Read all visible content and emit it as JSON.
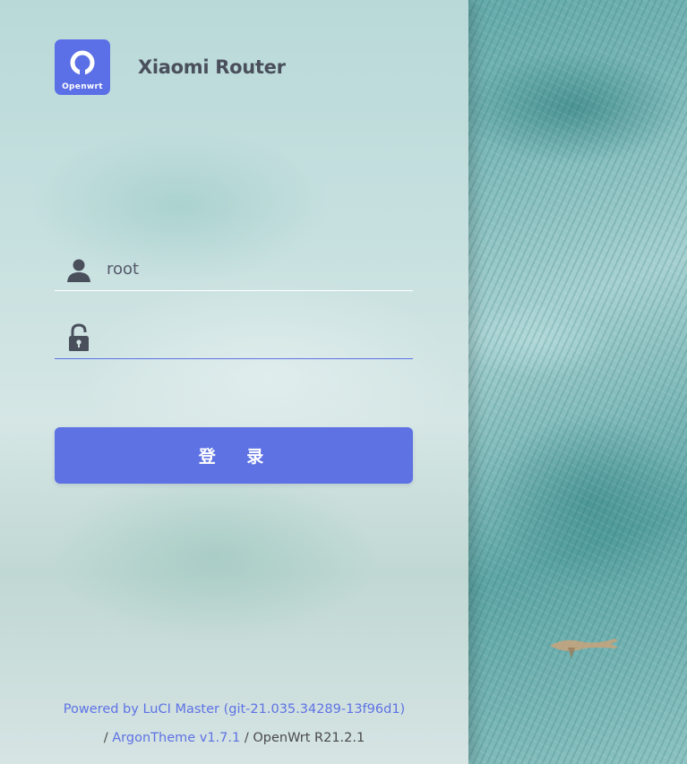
{
  "brand": {
    "logo_text": "Openwrt",
    "title": "Xiaomi Router"
  },
  "login_form": {
    "username_value": "root",
    "password_value": "",
    "submit_label": "登 录"
  },
  "footer": {
    "powered_by": "Powered by LuCI Master (git-21.035.34289-13f96d1)",
    "separator_1": "/",
    "theme_link": "ArgonTheme v1.7.1",
    "separator_2": "/",
    "os_version": "OpenWrt R21.2.1"
  },
  "colors": {
    "accent": "#5e72e4",
    "icon": "#4a4f5c"
  },
  "icons": {
    "user": "user-icon",
    "password": "unlock-icon"
  }
}
